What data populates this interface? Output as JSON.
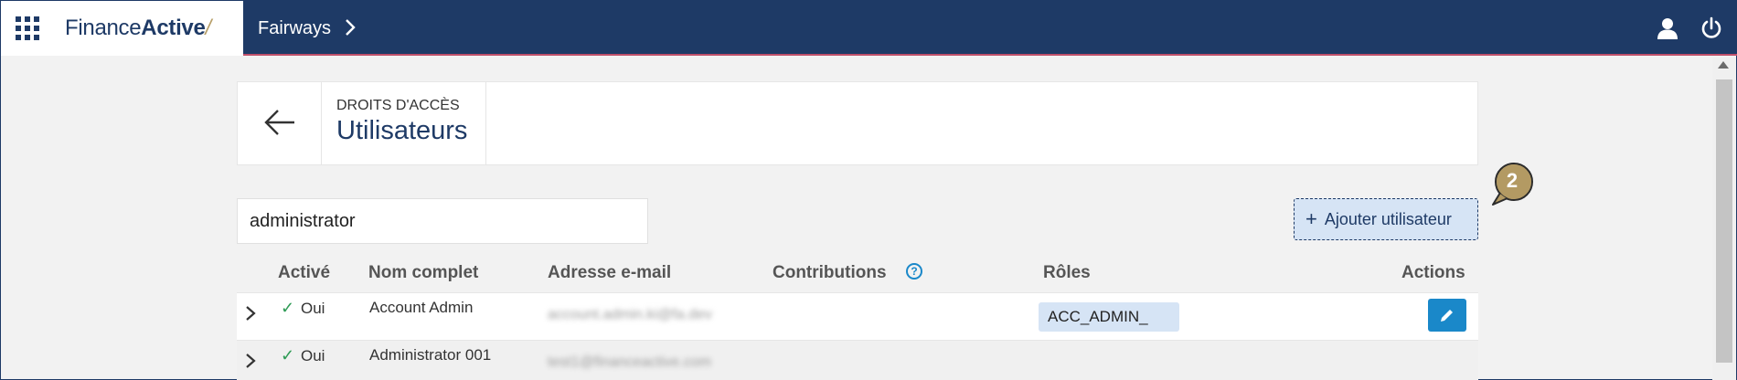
{
  "topbar": {
    "brand_regular": "Finance",
    "brand_bold": "Active",
    "app_title": "Fairways",
    "icons": [
      "apps-grid-icon",
      "chevron-right-icon",
      "user-icon",
      "power-icon"
    ]
  },
  "header": {
    "kicker": "DROITS D'ACCÈS",
    "title": "Utilisateurs"
  },
  "search": {
    "value": "administrator"
  },
  "toolbar": {
    "add_user_label": "Ajouter utilisateur",
    "step_badge": "2"
  },
  "table": {
    "columns": {
      "active": "Activé",
      "name": "Nom complet",
      "email": "Adresse e-mail",
      "contributions": "Contributions",
      "roles": "Rôles",
      "actions": "Actions"
    },
    "rows": [
      {
        "active": "Oui",
        "name": "Account Admin",
        "email": "account.admin.ki@fa.dev",
        "role": "ACC_ADMIN_"
      },
      {
        "active": "Oui",
        "name": "Administrator 001",
        "email": "test1@financeactive.com",
        "role": ""
      }
    ]
  },
  "colors": {
    "navy": "#1e3a66",
    "accent_blue": "#1a88c9",
    "chip_bg": "#d6e4f5",
    "success_green": "#2e9b55",
    "badge_gold": "#b39a63"
  }
}
